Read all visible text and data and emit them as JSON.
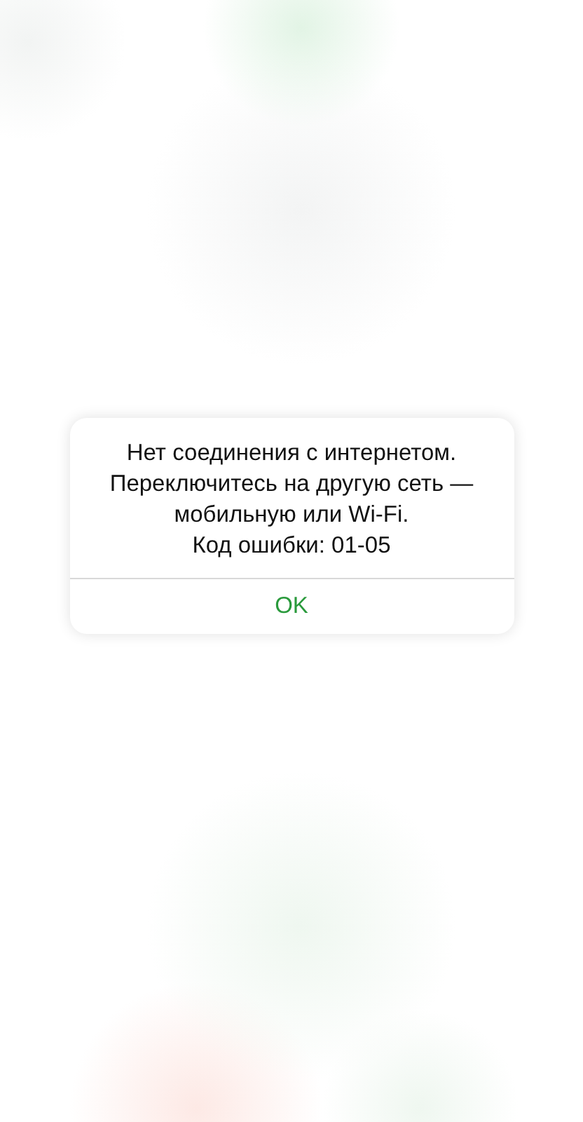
{
  "alert": {
    "message_lines": [
      "Нет соединения с интернетом.",
      "Переключитесь на другую сеть —",
      "мобильную или Wi-Fi.",
      "Код ошибки: 01-05"
    ],
    "button": "OK"
  }
}
